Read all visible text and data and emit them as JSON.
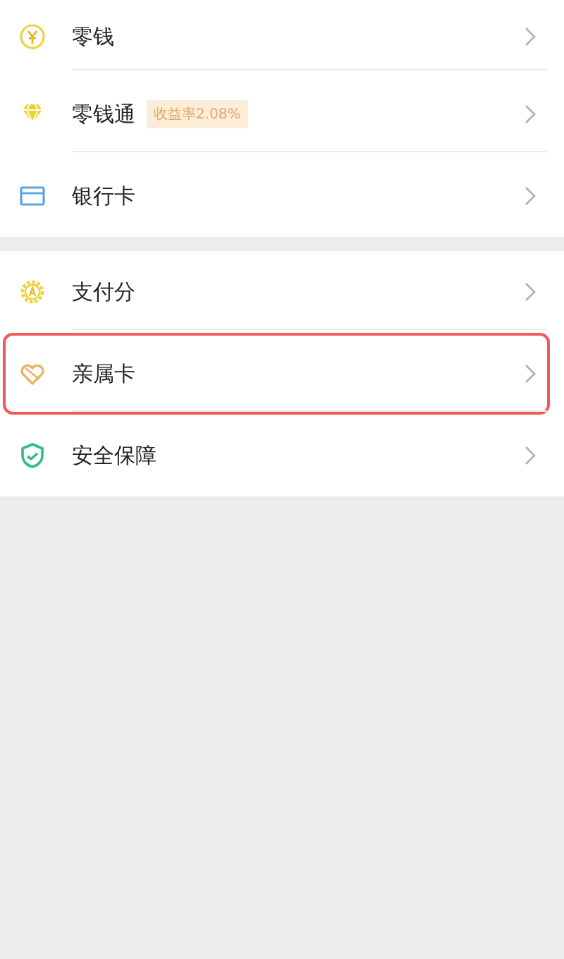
{
  "groups": [
    {
      "items": [
        {
          "kind": "coin",
          "label": "零钱",
          "highlighted": false
        },
        {
          "kind": "diamond",
          "label": "零钱通",
          "badge": "收益率2.08%",
          "highlighted": false
        },
        {
          "kind": "card",
          "label": "银行卡",
          "highlighted": false
        }
      ]
    },
    {
      "items": [
        {
          "kind": "badge",
          "label": "支付分",
          "highlighted": false
        },
        {
          "kind": "heart",
          "label": "亲属卡",
          "highlighted": true
        },
        {
          "kind": "shield",
          "label": "安全保障",
          "highlighted": false
        }
      ]
    }
  ]
}
